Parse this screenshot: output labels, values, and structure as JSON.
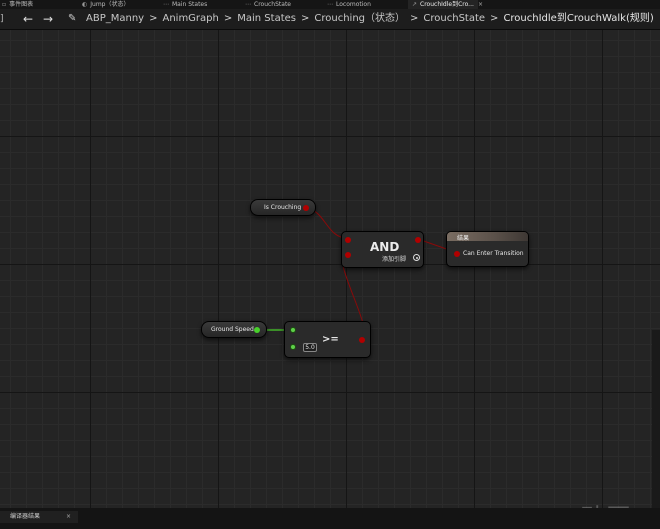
{
  "tabs": [
    {
      "label": "事件图表",
      "icon": "graph-icon",
      "active": false
    },
    {
      "label": "Jump（状态）",
      "icon": "state-icon",
      "active": false
    },
    {
      "label": "Main States",
      "icon": "state-machine-icon",
      "active": false
    },
    {
      "label": "CrouchState",
      "icon": "state-machine-icon",
      "active": false
    },
    {
      "label": "Locomotion",
      "icon": "state-machine-icon",
      "active": false
    },
    {
      "label": "CrouchIdle到Cro...",
      "icon": "transition-icon",
      "active": true
    }
  ],
  "tab_close": "×",
  "toolbar": {
    "menu_stub": "]",
    "back": "←",
    "forward": "→",
    "edit_icon": "pencil-icon"
  },
  "breadcrumbs": [
    "ABP_Manny",
    "AnimGraph",
    "Main States",
    "Crouching（状态）",
    "CrouchState",
    "CrouchIdle到CrouchWalk(规则)"
  ],
  "breadcrumb_sep": ">",
  "nodes": {
    "is_crouching": {
      "label": "Is Crouching"
    },
    "and": {
      "title": "AND",
      "add_pin": "添加引脚"
    },
    "result": {
      "title": "结果",
      "pin_label": "Can Enter Transition"
    },
    "ground_speed": {
      "label": "Ground Speed"
    },
    "compare": {
      "op": ">=",
      "value": "5.0"
    }
  },
  "colors": {
    "bool_pin": "#b10000",
    "float_pin": "#48d02b",
    "canvas": "#242424"
  },
  "watermark": "动画",
  "bottom_tab": {
    "label": "编译器结果",
    "close": "×"
  }
}
